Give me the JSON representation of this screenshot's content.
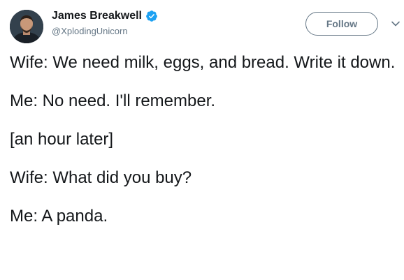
{
  "author": {
    "display_name": "James Breakwell",
    "handle": "@XplodingUnicorn",
    "verified": true
  },
  "actions": {
    "follow_label": "Follow"
  },
  "icons": {
    "verified": "verified-badge-icon",
    "more": "chevron-down-icon",
    "avatar": "avatar"
  },
  "colors": {
    "verified_blue": "#1da1f2",
    "secondary_text": "#657786",
    "primary_text": "#14171a"
  },
  "tweet": {
    "lines": [
      "Wife: We need milk, eggs, and bread. Write it down.",
      "Me: No need. I'll remember.",
      "[an hour later]",
      "Wife: What did you buy?",
      "Me: A panda."
    ]
  }
}
